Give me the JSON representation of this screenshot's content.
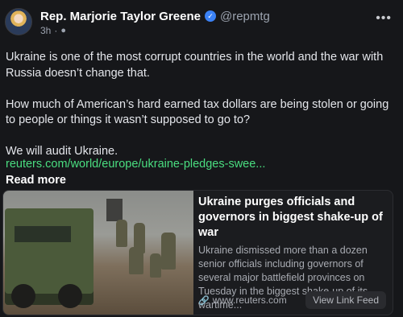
{
  "author": {
    "name": "Rep. Marjorie Taylor Greene",
    "handle": "@repmtg",
    "time": "3h",
    "separator": "·"
  },
  "icons": {
    "verified": "verified-badge-icon",
    "globe": "globe-icon",
    "more": "more-icon",
    "link": "link-icon"
  },
  "post": {
    "paragraphs": [
      "Ukraine is one of the most corrupt countries in the world and the war with Russia doesn’t change that.",
      "How much of American’s hard earned tax dollars are being stolen or going to people or things it wasn’t supposed to go to?",
      "We will audit Ukraine."
    ],
    "link": "reuters.com/world/europe/ukraine-pledges-swee...",
    "read_more": "Read more"
  },
  "card": {
    "title": "Ukraine purges officials and governors in biggest shake-up of war",
    "description": "Ukraine dismissed more than a dozen senior officials including governors of several major battlefield provinces on Tuesday in the biggest shake-up of its wartime...",
    "source": "www.reuters.com",
    "button": "View Link Feed"
  },
  "colors": {
    "background": "#16171a",
    "link": "#4ade80",
    "verified": "#3b82f6"
  }
}
